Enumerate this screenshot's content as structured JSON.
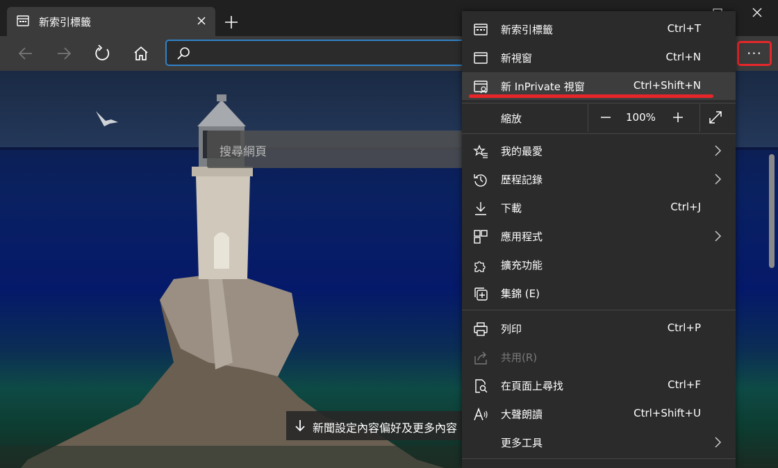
{
  "tab": {
    "title": "新索引標籤"
  },
  "search_placeholder": "搜尋網頁",
  "news_text": "新聞設定內容偏好及更多內容",
  "colors": {
    "accent": "#2f82c9",
    "highlight": "#e8262a",
    "menu_bg": "#2b2b2b"
  },
  "menu": {
    "new_tab": {
      "label": "新索引標籤",
      "shortcut": "Ctrl+T"
    },
    "new_window": {
      "label": "新視窗",
      "shortcut": "Ctrl+N"
    },
    "inprivate": {
      "label": "新 InPrivate 視窗",
      "shortcut": "Ctrl+Shift+N"
    },
    "zoom": {
      "label": "縮放",
      "value": "100%"
    },
    "favorites": {
      "label": "我的最愛"
    },
    "history": {
      "label": "歷程記錄"
    },
    "downloads": {
      "label": "下載",
      "shortcut": "Ctrl+J"
    },
    "apps": {
      "label": "應用程式"
    },
    "extensions": {
      "label": "擴充功能"
    },
    "collections": {
      "label": "集錦 (E)"
    },
    "print": {
      "label": "列印",
      "shortcut": "Ctrl+P"
    },
    "share": {
      "label": "共用(R)"
    },
    "find": {
      "label": "在頁面上尋找",
      "shortcut": "Ctrl+F"
    },
    "read_aloud": {
      "label": "大聲朗讀",
      "shortcut": "Ctrl+Shift+U"
    },
    "more_tools": {
      "label": "更多工具"
    }
  }
}
